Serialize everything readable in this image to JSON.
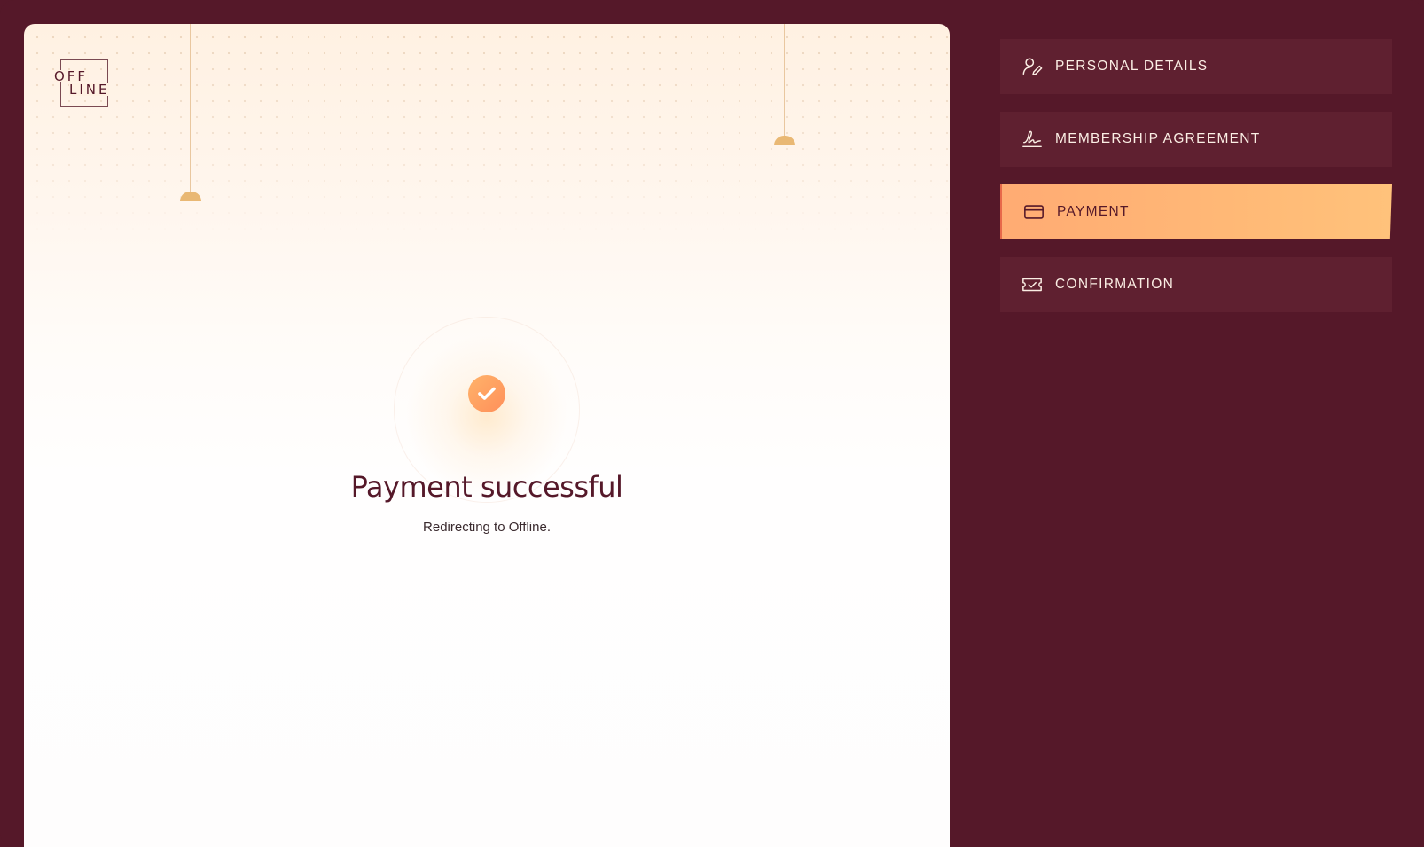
{
  "logo": {
    "line1": "OFF",
    "line2": "LINE"
  },
  "status": {
    "title": "Payment successful",
    "subtitle": "Redirecting to Offline."
  },
  "steps": [
    {
      "label": "PERSONAL DETAILS",
      "icon": "user-edit-icon",
      "active": false
    },
    {
      "label": "MEMBERSHIP AGREEMENT",
      "icon": "signature-icon",
      "active": false
    },
    {
      "label": "PAYMENT",
      "icon": "credit-card-icon",
      "active": true
    },
    {
      "label": "CONFIRMATION",
      "icon": "ticket-check-icon",
      "active": false
    }
  ],
  "colors": {
    "background": "#551829",
    "accent": "#ffab73",
    "title": "#551829",
    "success": "#ff8f5a"
  }
}
